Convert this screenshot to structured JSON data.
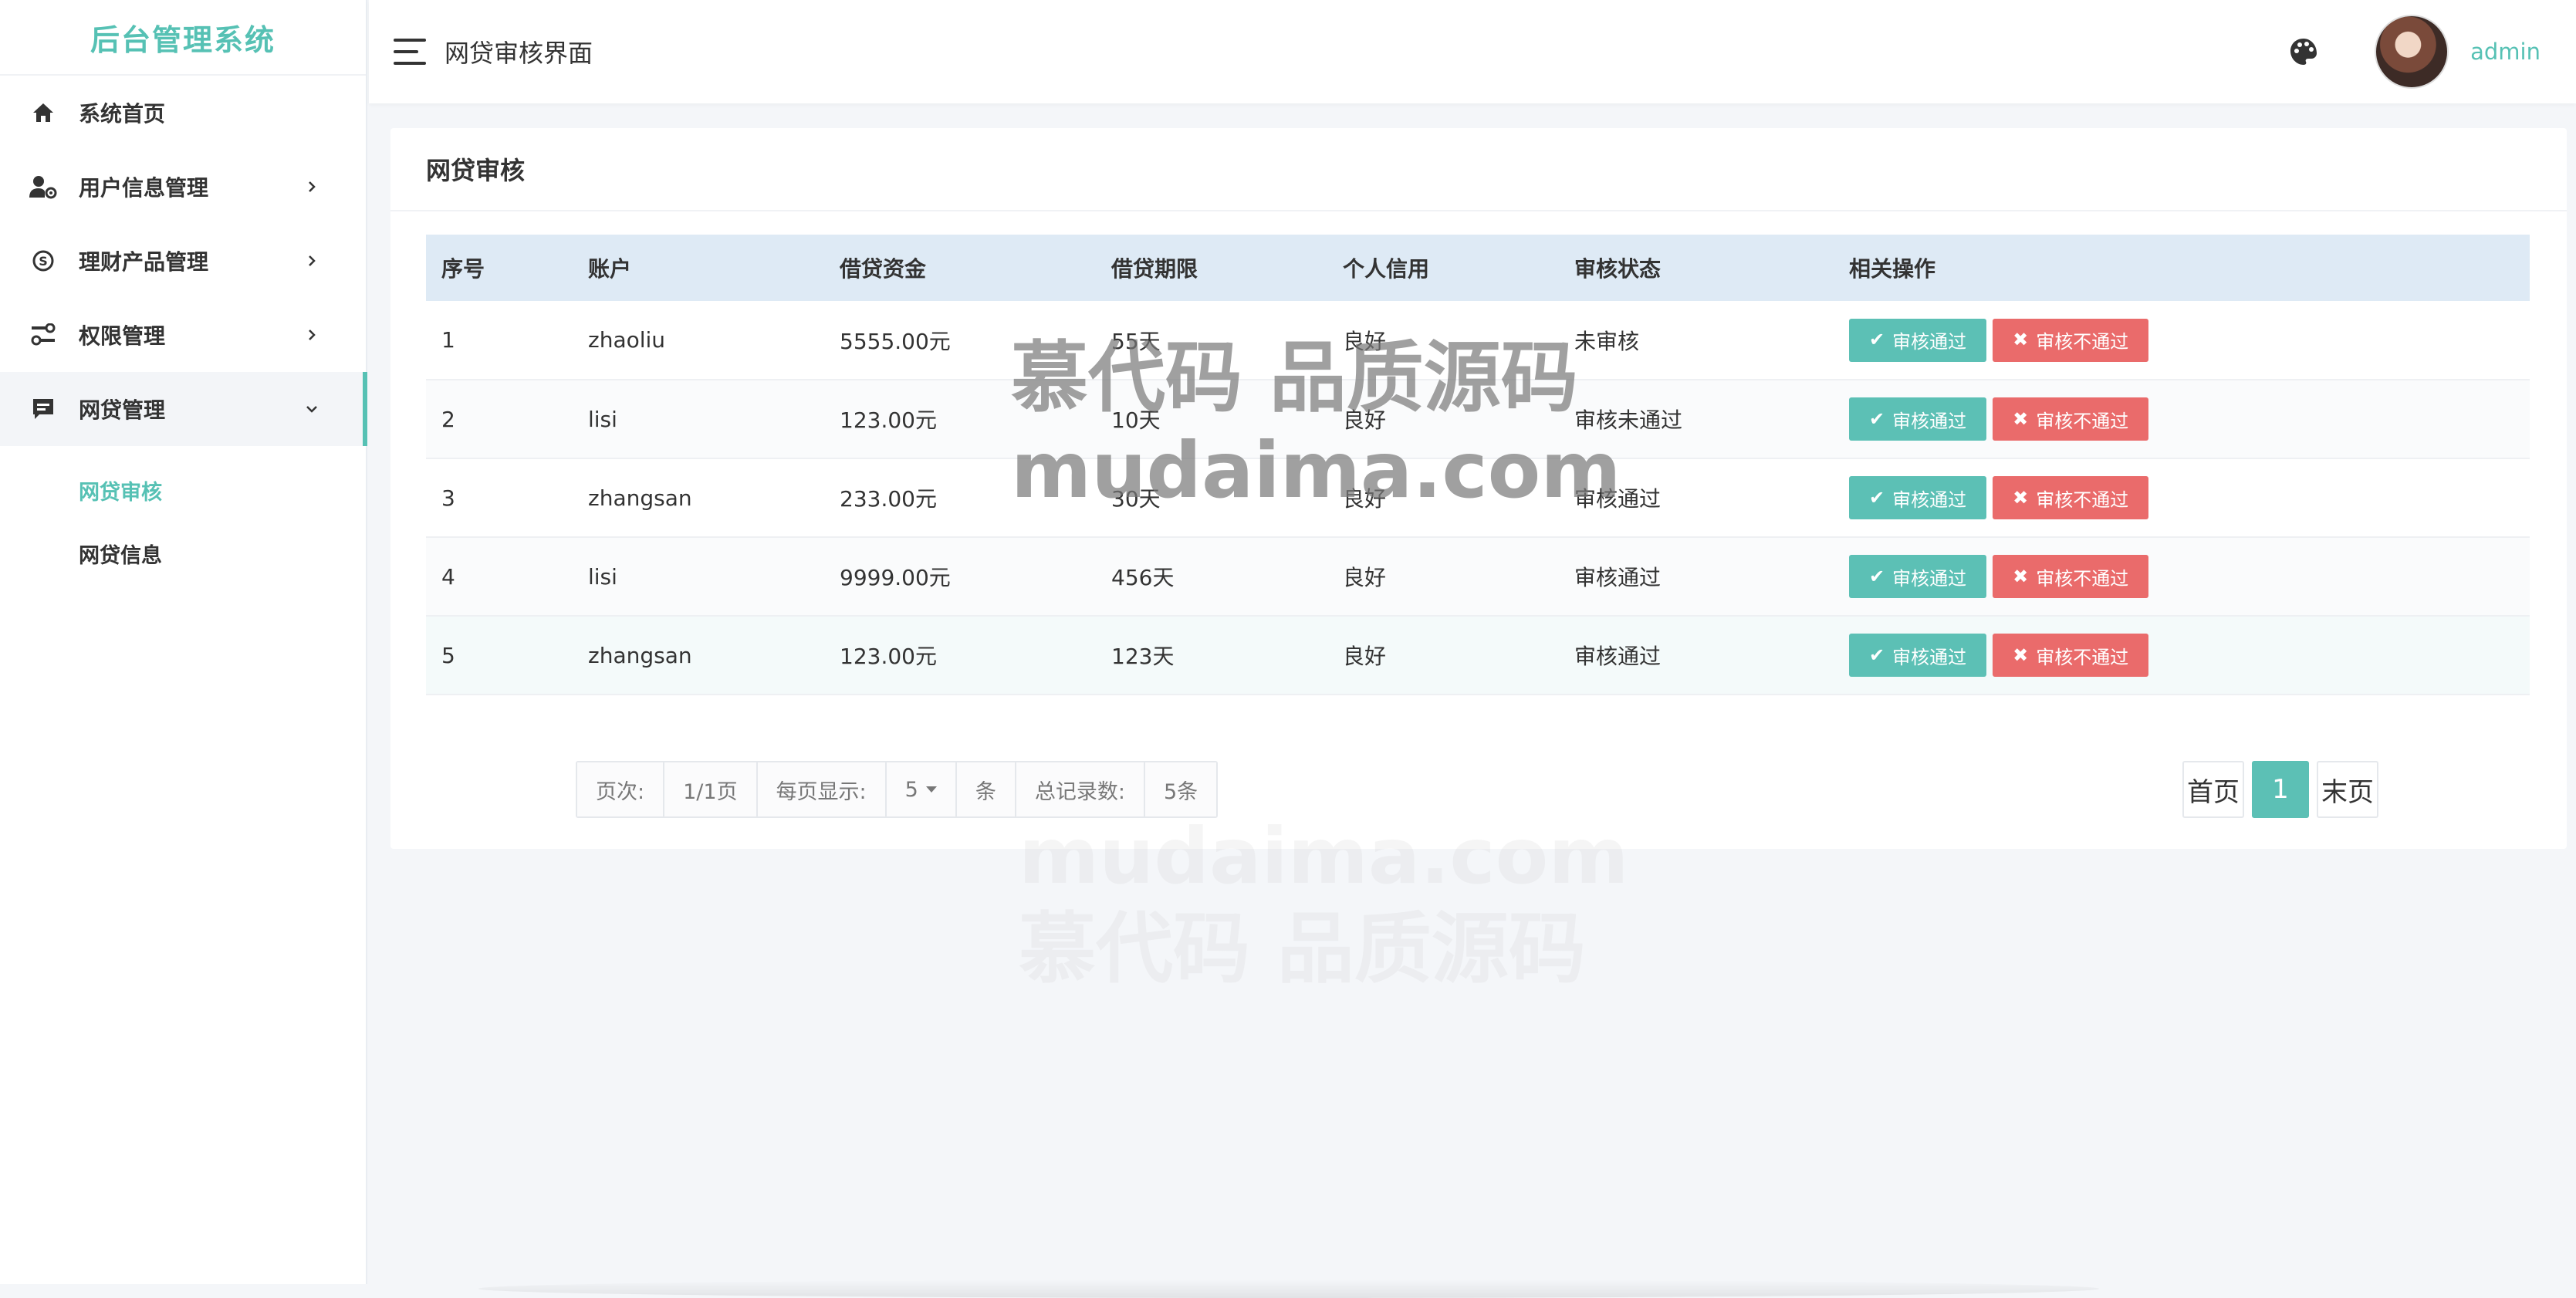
{
  "sidebar": {
    "brand": "后台管理系统",
    "items": [
      {
        "label": "系统首页"
      },
      {
        "label": "用户信息管理"
      },
      {
        "label": "理财产品管理"
      },
      {
        "label": "权限管理"
      },
      {
        "label": "网贷管理"
      }
    ],
    "sub_items": [
      {
        "label": "网贷审核"
      },
      {
        "label": "网贷信息"
      }
    ]
  },
  "topbar": {
    "title": "网贷审核界面",
    "username": "admin"
  },
  "card": {
    "title": "网贷审核"
  },
  "table": {
    "headers": [
      "序号",
      "账户",
      "借贷资金",
      "借贷期限",
      "个人信用",
      "审核状态",
      "相关操作"
    ],
    "rows": [
      [
        "1",
        "zhaoliu",
        "5555.00元",
        "55天",
        "良好",
        "未审核"
      ],
      [
        "2",
        "lisi",
        "123.00元",
        "10天",
        "良好",
        "审核未通过"
      ],
      [
        "3",
        "zhangsan",
        "233.00元",
        "30天",
        "良好",
        "审核通过"
      ],
      [
        "4",
        "lisi",
        "9999.00元",
        "456天",
        "良好",
        "审核通过"
      ],
      [
        "5",
        "zhangsan",
        "123.00元",
        "123天",
        "良好",
        "审核通过"
      ]
    ],
    "approve_label": "审核通过",
    "reject_label": "审核不通过"
  },
  "pager_info": {
    "page_label": "页次:",
    "page_value": "1/1页",
    "per_page_label": "每页显示:",
    "per_page_value": "5",
    "per_page_unit": "条",
    "total_label": "总记录数:",
    "total_value": "5条"
  },
  "pager": {
    "first": "首页",
    "current": "1",
    "last": "末页"
  },
  "watermark": {
    "line1": "慕代码 品质源码",
    "line2": "mudaima.com"
  },
  "colors": {
    "accent": "#56c1b4",
    "approve": "#5cc0b5",
    "reject": "#ea6b6b",
    "table_header": "#deeaf5"
  }
}
